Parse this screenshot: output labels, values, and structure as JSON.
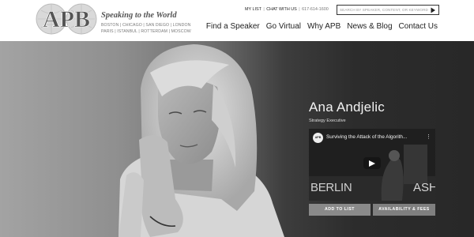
{
  "brand": {
    "logo_text": "APB",
    "tagline": "Speaking to the World",
    "cities_line1": "BOSTON | CHICAGO | SAN DIEGO | LONDON",
    "cities_line2": "PARIS | ISTANBUL | ROTTERDAM | MOSCOW"
  },
  "top_links": {
    "my_list": "MY LIST",
    "chat": "CHAT WITH US",
    "phone": "617-614-1600"
  },
  "search": {
    "placeholder": "SEARCH BY SPEAKER, CONTENT, OR KEYWORD"
  },
  "nav": {
    "items": [
      "Find a Speaker",
      "Go Virtual",
      "Why APB",
      "News & Blog",
      "Contact Us"
    ]
  },
  "speaker": {
    "name": "Ana Andjelic",
    "title": "Strategy Executive"
  },
  "video": {
    "channel_logo": "APB",
    "title": "Surviving the Attack of the Algorith...",
    "scene_text_left": "BERLIN",
    "scene_text_right": "ASHI"
  },
  "buttons": {
    "add_to_list": "ADD TO LIST",
    "availability": "AVAILABILITY & FEES"
  },
  "icons": {
    "search_go": "triangle-right-icon",
    "play": "play-icon",
    "video_menu": "kebab-menu-icon"
  }
}
